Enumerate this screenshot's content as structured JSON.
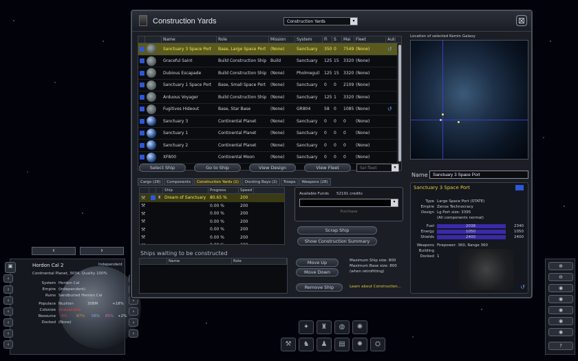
{
  "window": {
    "title": "Construction Yards",
    "filter_dropdown": "Construction Yards",
    "close_label": "⊠"
  },
  "ship_table": {
    "columns": [
      "Name",
      "Role",
      "Mission",
      "System",
      "Fi",
      "S",
      "Mai",
      "Fleet",
      "Auto"
    ],
    "rows": [
      {
        "name": "Sanctuary 3 Space Port",
        "role": "Base, Large Space Port",
        "mission": "(None)",
        "system": "Sanctuary",
        "f": "350",
        "s": "0",
        "m": "7549",
        "fleet": "(None)",
        "auto": true
      },
      {
        "name": "Graceful Saint",
        "role": "Build Construction Ship",
        "mission": "Build",
        "system": "Sanctuary",
        "f": "125",
        "s": "15",
        "m": "3320",
        "fleet": "(None)",
        "auto": false
      },
      {
        "name": "Dubious Escapade",
        "role": "Build Construction Ship",
        "mission": "(None)",
        "system": "Pholmeguil",
        "f": "125",
        "s": "15",
        "m": "3320",
        "fleet": "(None)",
        "auto": false
      },
      {
        "name": "Sanctuary 1 Space Port",
        "role": "Base, Small Space Port",
        "mission": "(None)",
        "system": "Sanctuary",
        "f": "0",
        "s": "0",
        "m": "2109",
        "fleet": "(None)",
        "auto": false
      },
      {
        "name": "Arduous Voyager",
        "role": "Build Construction Ship",
        "mission": "(None)",
        "system": "Sanctuary",
        "f": "125",
        "s": "1",
        "m": "3320",
        "fleet": "(None)",
        "auto": false
      },
      {
        "name": "Fugitives Hideout",
        "role": "Base, Star Base",
        "mission": "(None)",
        "system": "GR804",
        "f": "58",
        "s": "0",
        "m": "1085",
        "fleet": "(None)",
        "auto": true
      },
      {
        "name": "Sanctuary 3",
        "role": "Continental Planet",
        "mission": "(None)",
        "system": "Sanctuary",
        "f": "0",
        "s": "0",
        "m": "0",
        "fleet": "(None)",
        "auto": false
      },
      {
        "name": "Sanctuary 1",
        "role": "Continental Planet",
        "mission": "(None)",
        "system": "Sanctuary",
        "f": "0",
        "s": "0",
        "m": "0",
        "fleet": "(None)",
        "auto": false
      },
      {
        "name": "Sanctuary 2",
        "role": "Continental Planet",
        "mission": "(None)",
        "system": "Sanctuary",
        "f": "0",
        "s": "0",
        "m": "0",
        "fleet": "(None)",
        "auto": false
      },
      {
        "name": "XF800",
        "role": "Continental Moon",
        "mission": "(None)",
        "system": "Sanctuary",
        "f": "0",
        "s": "0",
        "m": "0",
        "fleet": "(None)",
        "auto": false
      }
    ]
  },
  "actions": {
    "select_ship": "Select Ship",
    "goto_ship": "Go to Ship",
    "view_design": "View Design",
    "view_fleet": "View Fleet",
    "fleet_select": "Sel fleet"
  },
  "tabs": [
    "Cargo (28)",
    "Components",
    "Construction Yards (1)",
    "Docking Bays (2)",
    "Troops",
    "Weapons (28)"
  ],
  "construction": {
    "columns": [
      "Ship",
      "Progress",
      "Speed"
    ],
    "rows": [
      {
        "name": "Dream of Sanctuary",
        "progress": "80.65 %",
        "speed": "200"
      },
      {
        "name": "",
        "progress": "0.00 %",
        "speed": "200"
      },
      {
        "name": "",
        "progress": "0.00 %",
        "speed": "200"
      },
      {
        "name": "",
        "progress": "0.00 %",
        "speed": "200"
      },
      {
        "name": "",
        "progress": "0.00 %",
        "speed": "200"
      },
      {
        "name": "",
        "progress": "0.00 %",
        "speed": "200"
      },
      {
        "name": "",
        "progress": "0.00 %",
        "speed": "200"
      }
    ]
  },
  "funds": {
    "label": "Available Funds",
    "value": "52191 credits",
    "purchase": "Purchase"
  },
  "scrap_button": "Scrap Ship",
  "summary_button": "Show Construction Summary",
  "waiting": {
    "title": "Ships waiting to be constructed",
    "columns": [
      "",
      "Name",
      "Role"
    ]
  },
  "queue_buttons": {
    "move_up": "Move Up",
    "move_down": "Move Down",
    "remove": "Remove Ship"
  },
  "ship_limits": {
    "max_ship": "Maximum Ship size: 800",
    "max_base": "Maximum Base size: 800",
    "note": "(when retrofitting)"
  },
  "learn_link": "Learn about Construction...",
  "right_panel": {
    "location_label": "Location of selected Kemin Galaxy",
    "name_label": "Name",
    "name_value": "Sanctuary 3 Space Port",
    "ship_title": "Sanctuary 3 Space Port",
    "type_label": "Type",
    "type_value": "Large Space Port (STATE)",
    "empire_label": "Empire",
    "empire_value": "Zenox Technocracy",
    "design_label": "Design",
    "design_value": "Lg Port size: 3395",
    "design_note": "(All components normal)",
    "fuel_label": "Fuel",
    "fuel_value": "2038",
    "fuel_max": "2340",
    "energy_label": "Energy",
    "energy_value": "1050",
    "energy_max": "1050",
    "shields_label": "Shields",
    "shields_value": "2400",
    "shields_max": "2400",
    "weapons_label": "Weapons",
    "weapons_value": "Firepower: 360, Range 360",
    "building_label": "Building",
    "docked_label": "Docked",
    "docked_value": "1"
  },
  "planet_panel": {
    "name": "Hordon Cal 2",
    "status": "Independent",
    "desc": "Continental Planet, 3034, Quality 100%",
    "system_label": "System",
    "system_value": "Hordon Cal",
    "empire_label": "Empire",
    "empire_value": "(Independent)",
    "ruins_label": "Ruins",
    "ruins_value": "Sandburied Hemen Cal",
    "populace_label": "Populace",
    "populace_value": "Nuzilian",
    "populace_count": "308M",
    "populace_growth": "+18%",
    "colonize_label": "Colonize",
    "colonize_value": "Unavailable",
    "resource_label": "Resource",
    "res1": "4%",
    "res2": "87%",
    "res3": "56%",
    "res4": "85%",
    "res5": "+2%",
    "docked_label": "Docked",
    "docked_value": "(None)"
  },
  "colors": {
    "highlight": "#f3e85a",
    "accent_blue": "#2d57d8",
    "bar_purple": "#3a2aa8",
    "link": "#e0cc3c"
  }
}
